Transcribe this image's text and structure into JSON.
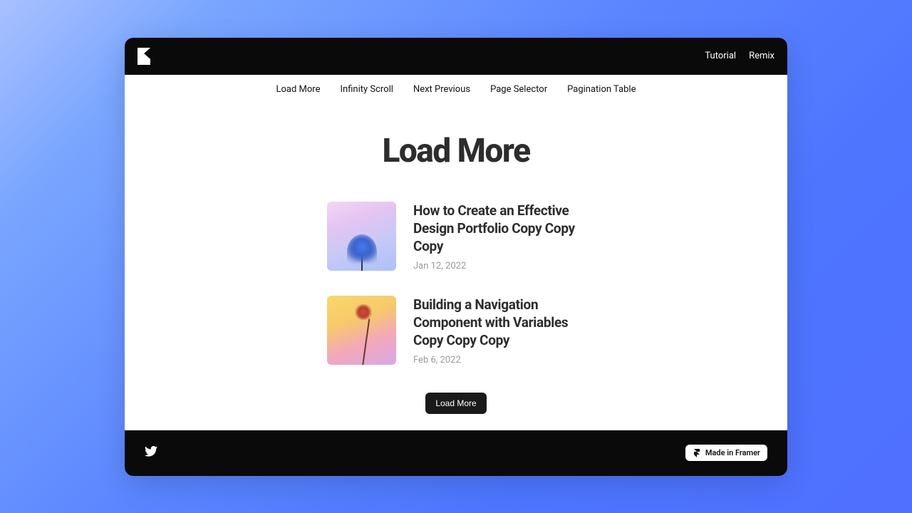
{
  "header": {
    "nav": [
      {
        "label": "Tutorial"
      },
      {
        "label": "Remix"
      }
    ]
  },
  "subnav": [
    {
      "label": "Load More"
    },
    {
      "label": "Infinity Scroll"
    },
    {
      "label": "Next Previous"
    },
    {
      "label": "Page Selector"
    },
    {
      "label": "Pagination Table"
    }
  ],
  "page": {
    "title": "Load More",
    "load_more_button": "Load More"
  },
  "posts": [
    {
      "title": "How to Create an Effective Design Portfolio Copy Copy Copy",
      "date": "Jan 12, 2022"
    },
    {
      "title": "Building a Navigation Component with Variables Copy Copy Copy",
      "date": "Feb 6, 2022"
    }
  ],
  "footer": {
    "badge": "Made in Framer"
  }
}
